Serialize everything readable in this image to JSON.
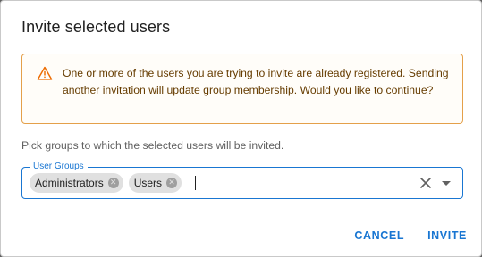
{
  "dialog": {
    "title": "Invite selected users",
    "warning": {
      "icon": "warning-icon",
      "text": "One or more of the users you are trying to invite are already registered. Sending another invitation will update group membership. Would you like to continue?"
    },
    "hint": "Pick groups to which the selected users will be invited.",
    "user_groups": {
      "label": "User Groups",
      "chips": [
        {
          "label": "Administrators"
        },
        {
          "label": "Users"
        }
      ],
      "value": ""
    },
    "actions": {
      "cancel_label": "CANCEL",
      "invite_label": "INVITE"
    }
  },
  "colors": {
    "primary": "#1976d2",
    "warning_border": "#e4a04a",
    "warning_text": "#663c00"
  }
}
